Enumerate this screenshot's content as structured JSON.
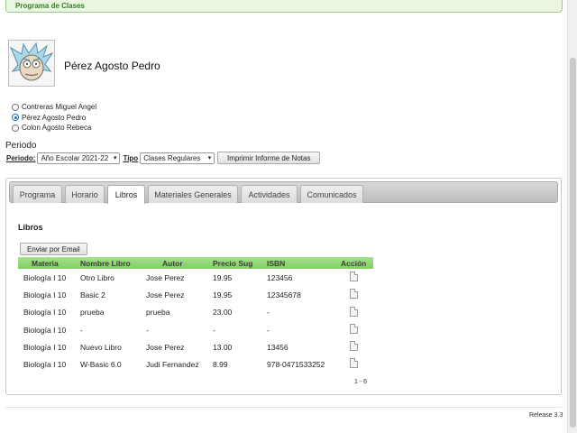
{
  "header": {
    "title": "Programa de Clases"
  },
  "profile": {
    "name": "Pérez Agosto Pedro",
    "avatar_icon": "rick-cartoon-avatar"
  },
  "students": [
    {
      "label": "Contreras Miguel Angel",
      "checked": false
    },
    {
      "label": "Pérez Agosto Pedro",
      "checked": true
    },
    {
      "label": "Colon Agosto Rebeca",
      "checked": false
    }
  ],
  "periodo_heading": "Periodo",
  "filters": {
    "periodo_label": "Periodo:",
    "periodo_value": "Año Escolar 2021-22",
    "tipo_label": "Tipo",
    "tipo_value": "Clases Regulares",
    "print_button": "Imprimir Informe de Notas"
  },
  "tabs": [
    "Programa",
    "Horario",
    "Libros",
    "Materiales Generales",
    "Actividades",
    "Comunicados"
  ],
  "active_tab": "Libros",
  "section_title": "Libros",
  "email_button": "Enviar por Email",
  "table": {
    "headers": [
      "Materia",
      "Nombre Libro",
      "Autor",
      "Precio Sug",
      "ISBN",
      "Acción"
    ],
    "rows": [
      [
        "Biología I 10",
        "Otro Libro",
        "Jose Perez",
        "19.95",
        "123456"
      ],
      [
        "Biología I 10",
        "Basic 2",
        "Jose Perez",
        "19.95",
        "12345678"
      ],
      [
        "Biología I 10",
        "prueba",
        "prueba",
        "23.00",
        "-"
      ],
      [
        "Biología I 10",
        "-",
        "-",
        "-",
        "-"
      ],
      [
        "Biología I 10",
        "Nuevo Libro",
        "Jose Perez",
        "13.00",
        "13456"
      ],
      [
        "Biología I 10",
        "W-Basic 6.0",
        "Judi Fernandez",
        "8.99",
        "978-0471533252"
      ]
    ],
    "action_icon": "document-icon"
  },
  "pager": "1 - 6",
  "release": "Release 3.3",
  "colors": {
    "header_green": "#7fcf62",
    "topbar_bg": "#e9f6e1",
    "topbar_text": "#3a7a25"
  }
}
